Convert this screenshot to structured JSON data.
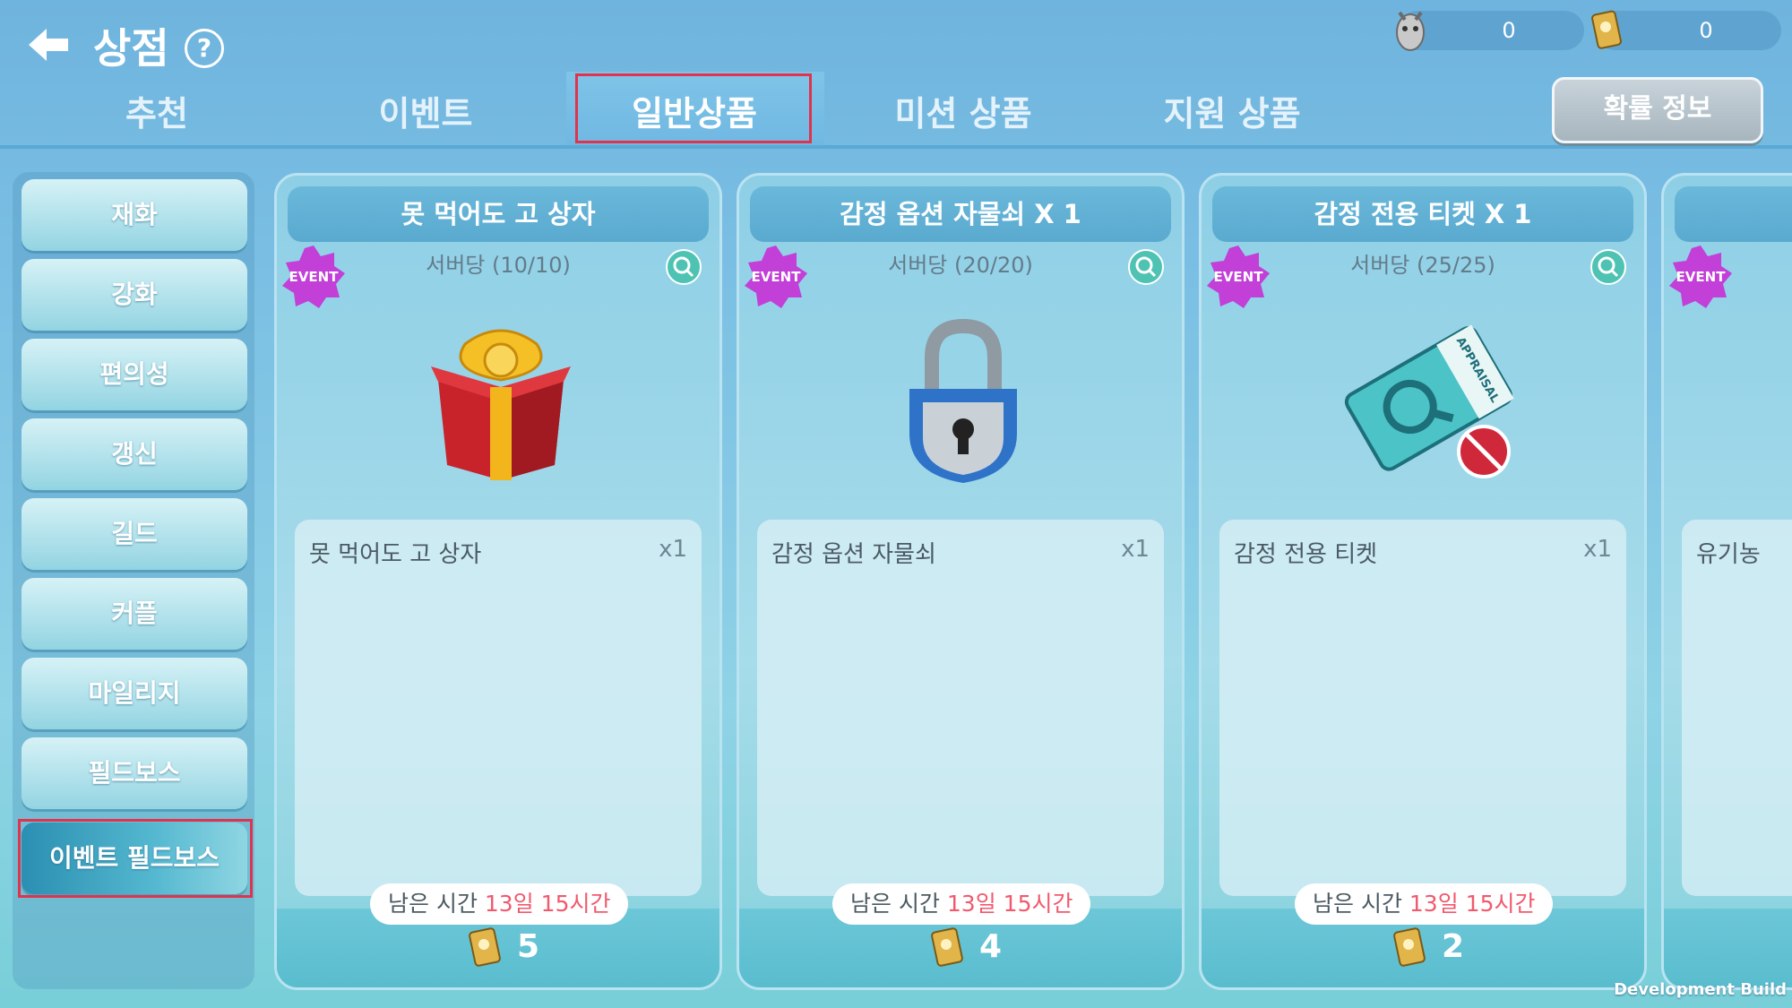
{
  "header": {
    "title": "상점",
    "help_label": "?",
    "currencies": [
      {
        "icon": "pet-currency-icon",
        "value": "0"
      },
      {
        "icon": "ticket-currency-icon",
        "value": "0"
      }
    ]
  },
  "tabs": [
    {
      "label": "추천",
      "active": false
    },
    {
      "label": "이벤트",
      "active": false
    },
    {
      "label": "일반상품",
      "active": true
    },
    {
      "label": "미션 상품",
      "active": false
    },
    {
      "label": "지원 상품",
      "active": false
    }
  ],
  "probability_button": "확률 정보",
  "sidebar": {
    "items": [
      {
        "label": "재화"
      },
      {
        "label": "강화"
      },
      {
        "label": "편의성"
      },
      {
        "label": "갱신"
      },
      {
        "label": "길드"
      },
      {
        "label": "커플"
      },
      {
        "label": "마일리지"
      },
      {
        "label": "필드보스"
      },
      {
        "label": "이벤트 필드보스",
        "active": true
      }
    ]
  },
  "cards": [
    {
      "title": "못 먹어도 고 상자",
      "badge": "EVENT",
      "limit": "서버당 (10/10)",
      "image": "gift-box-icon",
      "item_name": "못 먹어도 고 상자",
      "item_qty": "x1",
      "timer_label": "남은 시간",
      "timer_value": "13일 15시간",
      "price": "5"
    },
    {
      "title": "감정 옵션 자물쇠 X 1",
      "badge": "EVENT",
      "limit": "서버당 (20/20)",
      "image": "padlock-icon",
      "item_name": "감정 옵션 자물쇠",
      "item_qty": "x1",
      "timer_label": "남은 시간",
      "timer_value": "13일 15시간",
      "price": "4"
    },
    {
      "title": "감정 전용 티켓 X 1",
      "badge": "EVENT",
      "limit": "서버당 (25/25)",
      "image": "appraisal-ticket-icon",
      "item_name": "감정 전용 티켓",
      "item_qty": "x1",
      "timer_label": "남은 시간",
      "timer_value": "13일 15시간",
      "price": "2"
    },
    {
      "title": "",
      "badge": "EVENT",
      "item_name": "유기농"
    }
  ],
  "appraisal_ticket_text": "APPRAISAL",
  "footer_note": "Development Build",
  "colors": {
    "highlight": "#e0334d",
    "timer": "#f05a6e",
    "event_badge": "#c23fd8"
  }
}
